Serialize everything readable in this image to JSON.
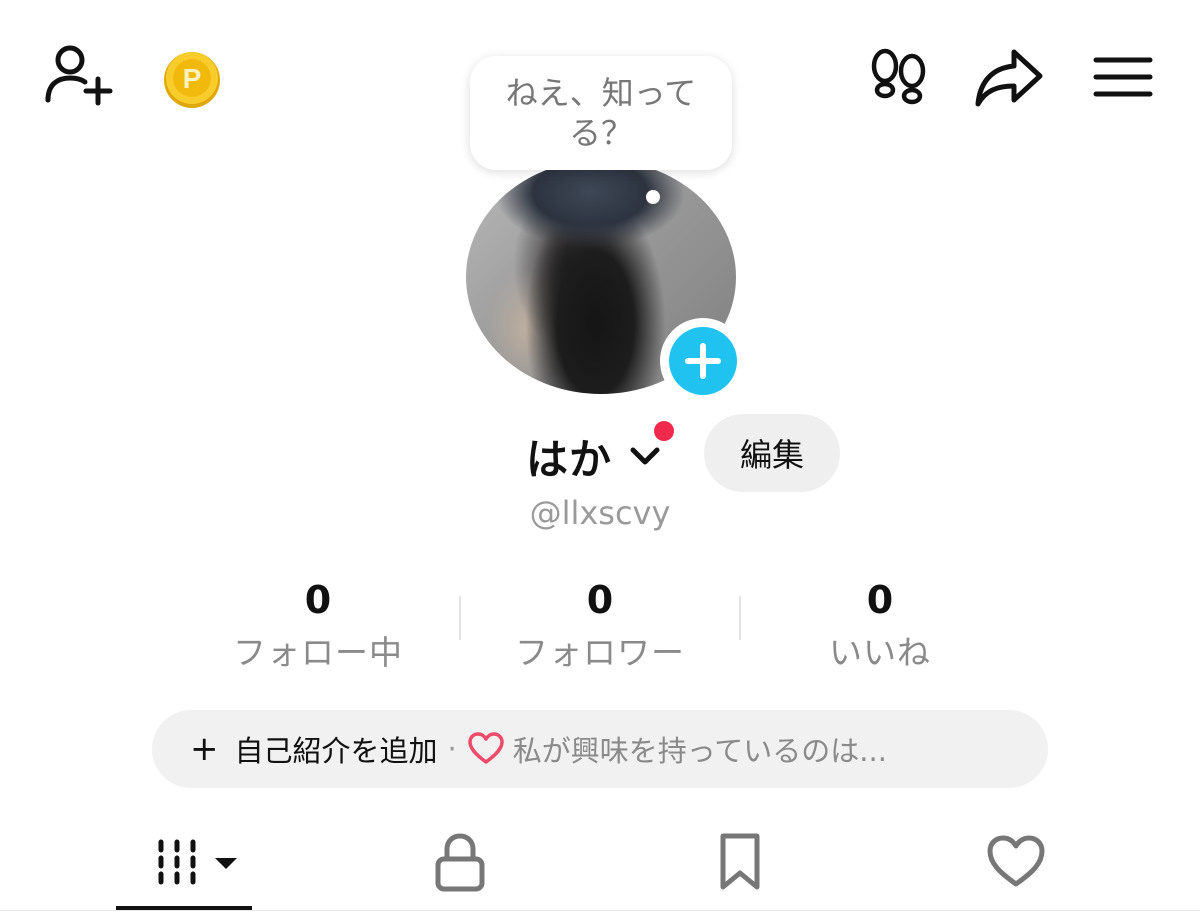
{
  "topbar": {
    "add_friend_icon": "person-plus-icon",
    "coin_icon": "p-coin-icon",
    "coin_letter": "P",
    "footprints_icon": "footprints-icon",
    "share_icon": "share-arrow-icon",
    "menu_icon": "hamburger-menu-icon"
  },
  "bubble": {
    "text": "ねえ、知ってる？"
  },
  "profile": {
    "name": "はか",
    "edit_label": "編集",
    "handle": "@llxscvy"
  },
  "stats": [
    {
      "value": "0",
      "label": "フォロー中"
    },
    {
      "value": "0",
      "label": "フォロワー"
    },
    {
      "value": "0",
      "label": "いいね"
    }
  ],
  "bio": {
    "plus": "+",
    "add_label": "自己紹介を追加",
    "separator": "·",
    "interest_text": "私が興味を持っているのは..."
  },
  "tabs": [
    {
      "icon": "grid-videos-icon"
    },
    {
      "icon": "lock-icon"
    },
    {
      "icon": "bookmark-icon"
    },
    {
      "icon": "heart-icon"
    }
  ],
  "colors": {
    "accent_blue": "#20c3ef",
    "notification_red": "#f0294d",
    "coin_gold": "#f5c518",
    "heart_pink": "#ef4a6a"
  }
}
